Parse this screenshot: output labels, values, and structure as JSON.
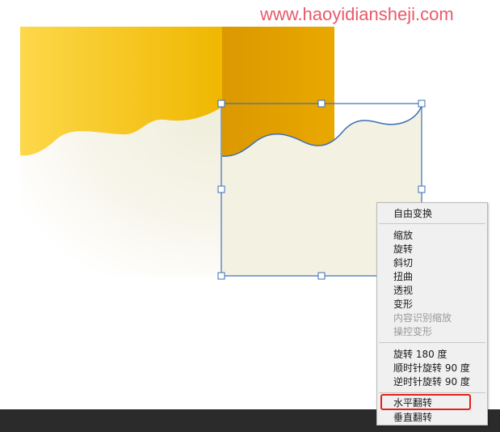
{
  "watermark": {
    "text": "www.haoyidiansheji.com"
  },
  "context_menu": {
    "group1": [
      "自由变换"
    ],
    "group2": [
      "缩放",
      "旋转",
      "斜切",
      "扭曲",
      "透视",
      "变形"
    ],
    "group2_disabled": [
      "内容识别缩放",
      "操控变形"
    ],
    "group3": [
      "旋转 180 度",
      "顺时针旋转 90 度",
      "逆时针旋转 90 度"
    ],
    "group4_highlighted": "水平翻转",
    "group4_other": "垂直翻转"
  },
  "colors": {
    "yellow_light": "#fcd545",
    "yellow_dark": "#f0b700",
    "orange_panel": "#e4a000",
    "cream": "#f3f1e2",
    "selection_blue": "#3d6fb5",
    "highlight_red": "#e0221c",
    "bottom_bar": "#2b2b2b"
  }
}
